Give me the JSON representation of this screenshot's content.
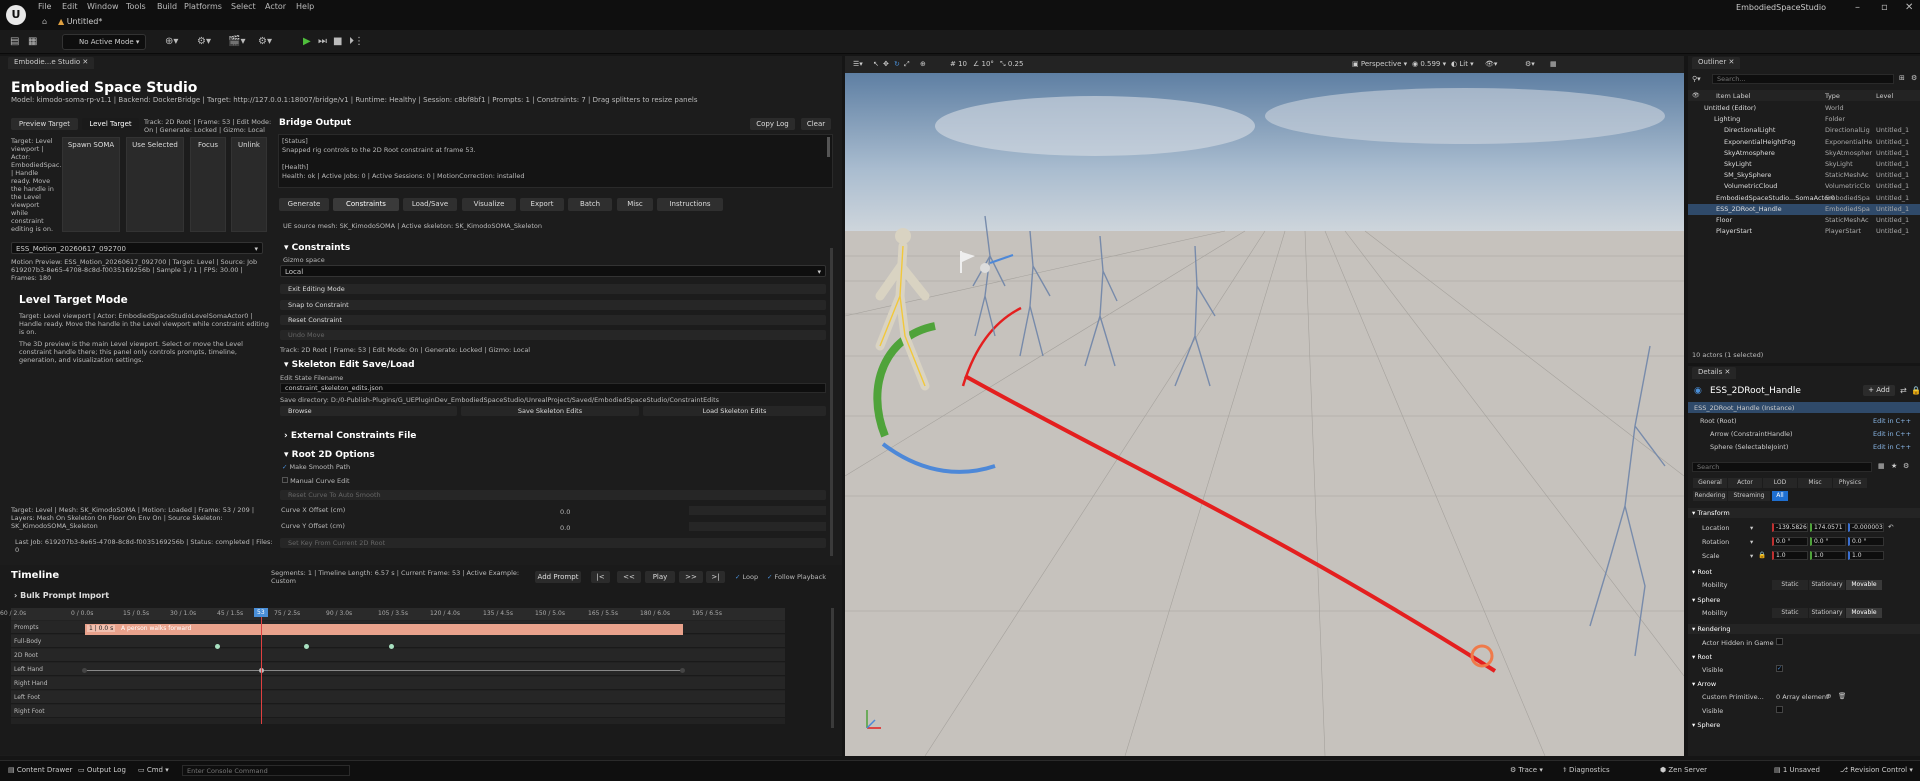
{
  "menubar": {
    "items": [
      "File",
      "Edit",
      "Window",
      "Tools",
      "Build",
      "Platforms",
      "Select",
      "Actor",
      "Help"
    ],
    "level_tab": "Untitled*",
    "window_title": "EmbodiedSpaceStudio"
  },
  "toolbar": {
    "mode": "No Active Mode"
  },
  "panel_tab": "Embodie...e Studio",
  "studio": {
    "title": "Embodied Space Studio",
    "model_line": "Model: kimodo-soma-rp-v1.1 | Backend: DockerBridge | Target: http://127.0.0.1:18007/bridge/v1 | Runtime: Healthy | Session: c8bf8bf1 | Prompts: 1 | Constraints: 7 | Drag splitters to resize panels",
    "preview_target": "Preview Target",
    "level_target": "Level Target",
    "track_info": "Track: 2D Root | Frame: 53 | Edit Mode: On | Generate: Locked | Gizmo: Local",
    "target_desc": "Target: Level viewport | Actor: EmbodiedSpac... | Handle ready. Move the handle in the Level viewport while constraint editing is on.",
    "cards": [
      "Spawn SOMA",
      "Use Selected",
      "Focus",
      "Unlink"
    ],
    "motion_select": "ESS_Motion_20260617_092700",
    "motion_preview": "Motion Preview: ESS_Motion_20260617_092700 | Target: Level | Source: Job 619207b3-8e65-4708-8c8d-f0035169256b | Sample 1 / 1 | FPS: 30.00 | Frames: 180",
    "level_mode_title": "Level Target Mode",
    "level_mode_text1": "Target: Level viewport | Actor: EmbodiedSpaceStudioLevelSomaActor0 | Handle ready. Move the handle in the Level viewport while constraint editing is on.",
    "level_mode_text2": "The 3D preview is the main Level viewport. Select or move the Level constraint handle there; this panel only controls prompts, timeline, generation, and visualization settings.",
    "bottom_info": "Target: Level | Mesh: SK_KimodoSOMA | Motion: Loaded | Frame: 53 / 209 | Layers: Mesh On Skeleton On Floor On Env On | Source Skeleton: SK_KimodoSOMA_Skeleton",
    "last_job": "Last Job: 619207b3-8e65-4708-8c8d-f0035169256b | Status: completed | Files: 0"
  },
  "bridge": {
    "title": "Bridge Output",
    "copy_log": "Copy Log",
    "clear": "Clear",
    "status_header": "[Status]",
    "status_text": "Snapped rig controls to the 2D Root constraint at frame 53.",
    "health_header": "[Health]",
    "health_text": "Health: ok | Active Jobs: 0 | Active Sessions: 0 | MotionCorrection: installed",
    "tabs": [
      "Generate",
      "Constraints",
      "Load/Save",
      "Visualize",
      "Export",
      "Batch",
      "Misc",
      "Instructions"
    ],
    "source_mesh": "UE source mesh: SK_KimodoSOMA | Active skeleton: SK_KimodoSOMA_Skeleton"
  },
  "constraints": {
    "header": "Constraints",
    "gizmo_label": "Gizmo space",
    "gizmo_value": "Local",
    "exit_edit": "Exit Editing Mode",
    "snap": "Snap to Constraint",
    "reset": "Reset Constraint",
    "undo": "Undo Move",
    "track_line": "Track: 2D Root | Frame: 53 | Edit Mode: On | Generate: Locked | Gizmo: Local"
  },
  "skeleton_save": {
    "header": "Skeleton Edit Save/Load",
    "filename_label": "Edit State Filename",
    "filename_value": "constraint_skeleton_edits.json",
    "save_dir": "Save directory: D:/0-Publish-Plugins/G_UEPluginDev_EmbodiedSpaceStudio/UnrealProject/Saved/EmbodiedSpaceStudio/ConstraintEdits",
    "browse": "Browse",
    "save": "Save Skeleton Edits",
    "load": "Load Skeleton Edits"
  },
  "ext_constraints": {
    "header": "External Constraints File"
  },
  "root2d": {
    "header": "Root 2D Options",
    "smooth": "Make Smooth Path",
    "manual": "Manual Curve Edit",
    "reset_curve": "Reset Curve To Auto Smooth",
    "x_label": "Curve X Offset (cm)",
    "x_value": "0.0",
    "y_label": "Curve Y Offset (cm)",
    "y_value": "0.0",
    "set_key": "Set Key From Current 2D Root"
  },
  "timeline": {
    "title": "Timeline",
    "info": "Segments: 1 | Timeline Length: 6.57 s | Current Frame: 53 | Active Example: Custom",
    "add_prompt": "Add Prompt",
    "first": "|<",
    "prev": "<<",
    "play": "Play",
    "next": ">>",
    "last": ">|",
    "loop": "Loop",
    "follow": "Follow Playback",
    "bulk": "Bulk Prompt Import",
    "ruler": [
      "0 / 0.0s",
      "15 / 0.5s",
      "30 / 1.0s",
      "45 / 1.5s",
      "53",
      "60 / 2.0s",
      "75 / 2.5s",
      "90 / 3.0s",
      "105 / 3.5s",
      "120 / 4.0s",
      "135 / 4.5s",
      "150 / 5.0s",
      "165 / 5.5s",
      "180 / 6.0s",
      "195 / 6.5s"
    ],
    "tracks": [
      "Prompts",
      "Full-Body",
      "2D Root",
      "Left Hand",
      "Right Hand",
      "Left Foot",
      "Right Foot"
    ],
    "prompt_clip": "1 | 0.0 s",
    "prompt_text": "A person walks forward"
  },
  "viewport": {
    "perspective": "Perspective",
    "lit": "Lit",
    "grid_snap": "10",
    "rot_snap": "10°",
    "scale_snap": "0.25",
    "camera_speed": "0.599"
  },
  "outliner": {
    "tab": "Outliner",
    "search": "Search...",
    "col_label": "Item Label",
    "col_type": "Type",
    "col_level": "Level",
    "rows": [
      {
        "label": "Untitled (Editor)",
        "type": "World",
        "level": ""
      },
      {
        "label": "Lighting",
        "type": "Folder",
        "level": ""
      },
      {
        "label": "DirectionalLight",
        "type": "DirectionalLig",
        "level": "Untitled_1"
      },
      {
        "label": "ExponentialHeightFog",
        "type": "ExponentialHe",
        "level": "Untitled_1"
      },
      {
        "label": "SkyAtmosphere",
        "type": "SkyAtmospher",
        "level": "Untitled_1"
      },
      {
        "label": "SkyLight",
        "type": "SkyLight",
        "level": "Untitled_1"
      },
      {
        "label": "SM_SkySphere",
        "type": "StaticMeshAc",
        "level": "Untitled_1"
      },
      {
        "label": "VolumetricCloud",
        "type": "VolumetricClo",
        "level": "Untitled_1"
      },
      {
        "label": "EmbodiedSpaceStudio...SomaActor0",
        "type": "EmbodiedSpa",
        "level": "Untitled_1"
      },
      {
        "label": "ESS_2DRoot_Handle",
        "type": "EmbodiedSpa",
        "level": "Untitled_1"
      },
      {
        "label": "Floor",
        "type": "StaticMeshAc",
        "level": "Untitled_1"
      },
      {
        "label": "PlayerStart",
        "type": "PlayerStart",
        "level": "Untitled_1"
      }
    ],
    "count": "10 actors (1 selected)"
  },
  "details": {
    "tab": "Details",
    "actor_name": "ESS_2DRoot_Handle",
    "add": "+ Add",
    "instance": "ESS_2DRoot_Handle (Instance)",
    "components": [
      {
        "name": "Root (Root)",
        "edit": "Edit in C++"
      },
      {
        "name": "Arrow (ConstraintHandle)",
        "edit": "Edit in C++"
      },
      {
        "name": "Sphere (SelectableJoint)",
        "edit": "Edit in C++"
      }
    ],
    "search": "Search",
    "filters1": [
      "General",
      "Actor",
      "LOD",
      "Misc",
      "Physics"
    ],
    "filters2": [
      "Rendering",
      "Streaming",
      "All"
    ],
    "transform": "Transform",
    "location": "Location",
    "loc_vals": [
      "-139.5826",
      "174.0571",
      "-0.000003"
    ],
    "rotation": "Rotation",
    "rot_vals": [
      "0.0 °",
      "0.0 °",
      "0.0 °"
    ],
    "scale": "Scale",
    "scale_vals": [
      "1.0",
      "1.0",
      "1.0"
    ],
    "root_header": "Root",
    "mobility": "Mobility",
    "mob_opts": [
      "Static",
      "Stationary",
      "Movable"
    ],
    "sphere_header": "Sphere",
    "rendering_header": "Rendering",
    "hidden_label": "Actor Hidden in Game",
    "root_header2": "Root",
    "visible": "Visible",
    "arrow_header": "Arrow",
    "custom_prim": "Custom Primitive...",
    "array_el": "0 Array element",
    "visible2": "Visible",
    "sphere_header2": "Sphere"
  },
  "statusbar": {
    "content_drawer": "Content Drawer",
    "output_log": "Output Log",
    "cmd": "Cmd",
    "console": "Enter Console Command",
    "trace": "Trace",
    "diagnostics": "Diagnostics",
    "zen": "Zen Server",
    "unsaved": "1 Unsaved",
    "revision": "Revision Control"
  }
}
